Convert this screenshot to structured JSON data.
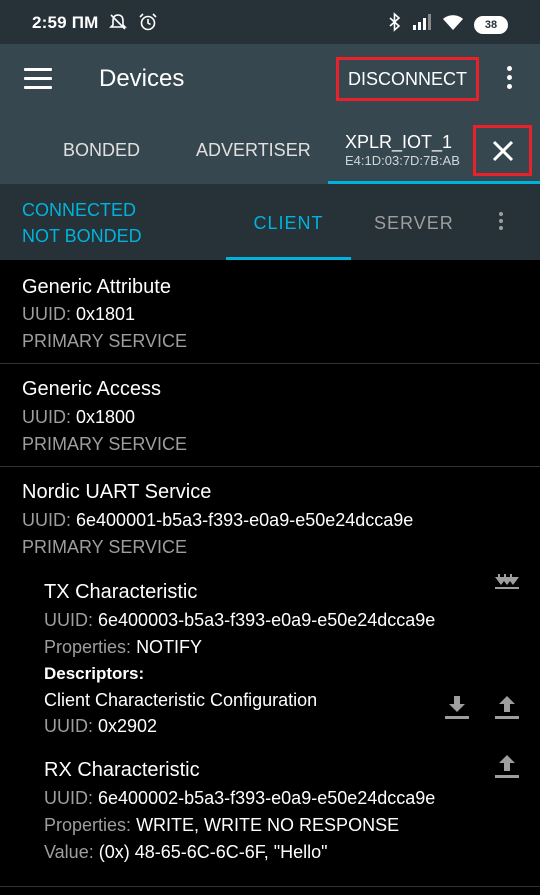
{
  "status_bar": {
    "time": "2:59 ПМ",
    "battery": "38",
    "icons": [
      "mute-icon",
      "alarm-icon",
      "bluetooth-icon",
      "signal-icon",
      "wifi-icon",
      "battery-icon"
    ]
  },
  "app_bar": {
    "title": "Devices",
    "disconnect_label": "DISCONNECT",
    "icons": [
      "menu-icon",
      "overflow-icon"
    ]
  },
  "device_tabs": {
    "tabs": [
      {
        "label": "BONDED"
      },
      {
        "label": "ADVERTISER"
      }
    ],
    "active_device": {
      "name": "XPLR_IOT_1",
      "address": "E4:1D:03:7D:7B:AB"
    },
    "close_icon": "close-icon"
  },
  "connection": {
    "state": "CONNECTED",
    "bond_state": "NOT BONDED",
    "tabs": [
      {
        "label": "CLIENT",
        "active": true
      },
      {
        "label": "SERVER",
        "active": false
      }
    ]
  },
  "services": [
    {
      "name": "Generic Attribute",
      "uuid_label": "UUID:",
      "uuid": "0x1801",
      "type": "PRIMARY SERVICE"
    },
    {
      "name": "Generic Access",
      "uuid_label": "UUID:",
      "uuid": "0x1800",
      "type": "PRIMARY SERVICE"
    },
    {
      "name": "Nordic UART Service",
      "uuid_label": "UUID:",
      "uuid": "6e400001-b5a3-f393-e0a9-e50e24dcca9e",
      "type": "PRIMARY SERVICE",
      "characteristics": [
        {
          "name": "TX Characteristic",
          "uuid_label": "UUID:",
          "uuid": "6e400003-b5a3-f393-e0a9-e50e24dcca9e",
          "properties_label": "Properties:",
          "properties": "NOTIFY",
          "descriptors_label": "Descriptors:",
          "descriptor_name": "Client Characteristic Configuration",
          "descriptor_uuid_label": "UUID:",
          "descriptor_uuid": "0x2902",
          "icons": [
            "notify-multiple-download-icon",
            "download-icon",
            "upload-icon"
          ]
        },
        {
          "name": "RX Characteristic",
          "uuid_label": "UUID:",
          "uuid": "6e400002-b5a3-f393-e0a9-e50e24dcca9e",
          "properties_label": "Properties:",
          "properties": "WRITE, WRITE NO RESPONSE",
          "value_label": "Value:",
          "value": "(0x) 48-65-6C-6C-6F, \"Hello\"",
          "icons": [
            "upload-icon"
          ]
        }
      ]
    }
  ],
  "colors": {
    "accent": "#00b3dc",
    "appbar": "#37474f",
    "statusbar": "#263238",
    "highlight": "#e8212b"
  }
}
